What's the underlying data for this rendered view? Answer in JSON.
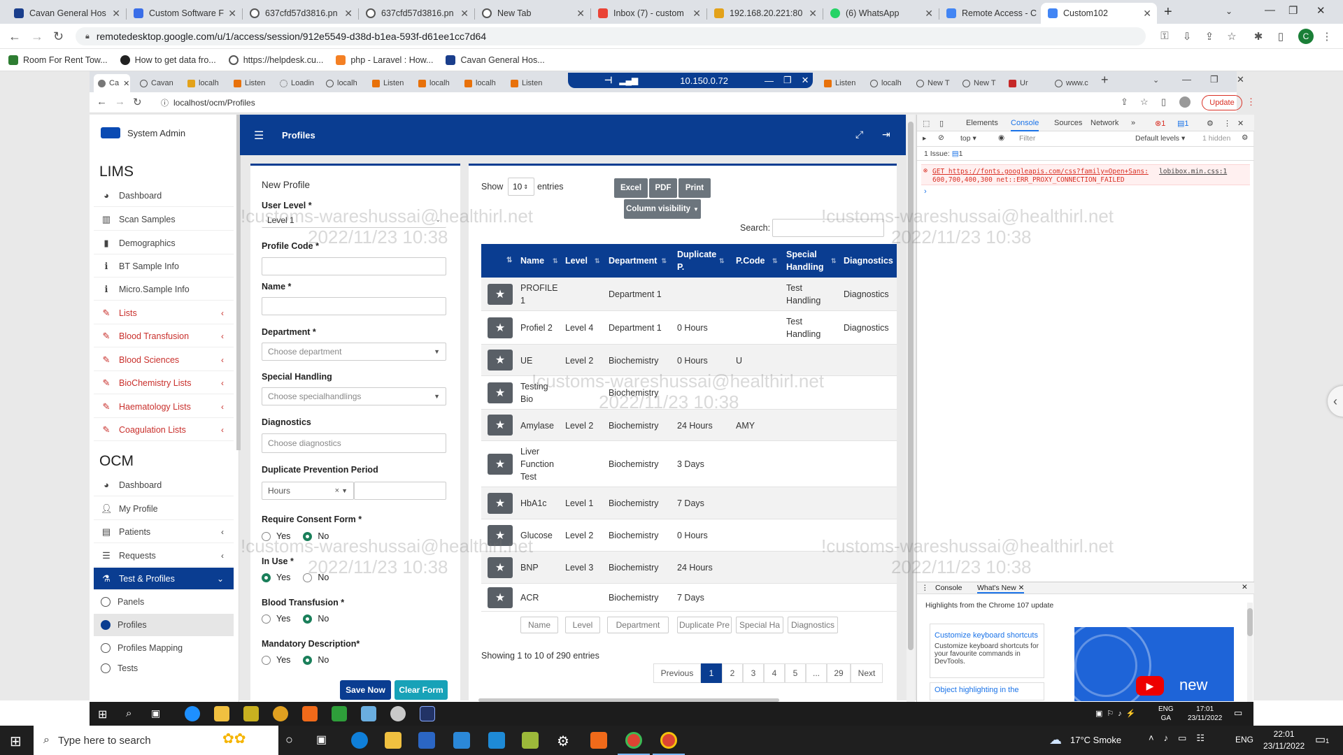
{
  "browser": {
    "tabs": [
      {
        "label": "Cavan General Hos"
      },
      {
        "label": "Custom Software F"
      },
      {
        "label": "637cfd57d3816.pn"
      },
      {
        "label": "637cfd57d3816.pn"
      },
      {
        "label": "New Tab"
      },
      {
        "label": "Inbox (7) - custom"
      },
      {
        "label": "192.168.20.221:80"
      },
      {
        "label": "(6) WhatsApp"
      },
      {
        "label": "Remote Access - C"
      },
      {
        "label": "Custom102"
      }
    ],
    "url": "remotedesktop.google.com/u/1/access/session/912e5549-d38d-b1ea-593f-d61ee1cc7d64",
    "profile_initial": "C",
    "bookmarks": [
      {
        "label": "Room For Rent Tow..."
      },
      {
        "label": "How to get data fro..."
      },
      {
        "label": "https://helpdesk.cu..."
      },
      {
        "label": "php - Laravel : How..."
      },
      {
        "label": "Cavan General Hos..."
      }
    ]
  },
  "remote": {
    "ip": "10.150.0.72",
    "inner_tabs": [
      "Ca",
      "Cavan",
      "localh",
      "Listen",
      "Loadin",
      "localh",
      "Listen",
      "localh",
      "localh",
      "Listen",
      "Listen",
      "localh",
      "New T",
      "New T",
      "Ur",
      "www.c"
    ],
    "inner_url": "localhost/ocm/Profiles",
    "update_label": "Update"
  },
  "sidebar": {
    "brand": "System Admin",
    "lims_title": "LIMS",
    "lims_items": [
      {
        "label": "Dashboard",
        "icon": "dashboard-icon"
      },
      {
        "label": "Scan Samples",
        "icon": "barcode-icon"
      },
      {
        "label": "Demographics",
        "icon": "file-icon"
      },
      {
        "label": "BT Sample Info",
        "icon": "info-icon"
      },
      {
        "label": "Micro.Sample Info",
        "icon": "info-icon"
      },
      {
        "label": "Lists",
        "icon": "pencil-icon"
      },
      {
        "label": "Blood Transfusion",
        "icon": "pencil-icon"
      },
      {
        "label": "Blood Sciences",
        "icon": "pencil-icon"
      },
      {
        "label": "BioChemistry Lists",
        "icon": "pencil-icon"
      },
      {
        "label": "Haematology Lists",
        "icon": "pencil-icon"
      },
      {
        "label": "Coagulation Lists",
        "icon": "pencil-icon"
      }
    ],
    "ocm_title": "OCM",
    "ocm_items": [
      {
        "label": "Dashboard"
      },
      {
        "label": "My Profile"
      },
      {
        "label": "Patients"
      },
      {
        "label": "Requests"
      },
      {
        "label": "Test & Profiles"
      },
      {
        "label": "Panels"
      },
      {
        "label": "Profiles"
      },
      {
        "label": "Profiles Mapping"
      },
      {
        "label": "Tests"
      }
    ]
  },
  "header": {
    "title": "Profiles"
  },
  "form": {
    "title": "New Profile",
    "user_level_label": "User Level *",
    "user_level_value": "Level 1",
    "profile_code_label": "Profile Code *",
    "name_label": "Name *",
    "department_label": "Department *",
    "department_placeholder": "Choose department",
    "special_label": "Special Handling",
    "special_placeholder": "Choose specialhandlings",
    "diagnostics_label": "Diagnostics",
    "diagnostics_placeholder": "Choose diagnostics",
    "dup_label": "Duplicate Prevention Period",
    "dup_unit": "Hours",
    "consent_label": "Require Consent Form *",
    "inuse_label": "In Use *",
    "bt_label": "Blood Transfusion *",
    "mand_label": "Mandatory Description*",
    "yes": "Yes",
    "no": "No",
    "save": "Save Now",
    "clear": "Clear Form"
  },
  "table": {
    "show": "Show",
    "entries_value": "10",
    "entries": "entries",
    "buttons": [
      "Excel",
      "PDF",
      "Print"
    ],
    "colvis": "Column visibility",
    "search_label": "Search:",
    "columns": [
      "Name",
      "Level",
      "Department",
      "Duplicate P.",
      "P.Code",
      "Special Handling",
      "Diagnostics"
    ],
    "rows": [
      {
        "name": "PROFILE 1",
        "level": "",
        "dept": "Department 1",
        "dup": "",
        "code": "",
        "special": "Test Handling",
        "diag": "Diagnostics"
      },
      {
        "name": "Profiel 2",
        "level": "Level 4",
        "dept": "Department 1",
        "dup": "0 Hours",
        "code": "",
        "special": "Test Handling",
        "diag": "Diagnostics"
      },
      {
        "name": "UE",
        "level": "Level 2",
        "dept": "Biochemistry",
        "dup": "0 Hours",
        "code": "U",
        "special": "",
        "diag": ""
      },
      {
        "name": "Testing Bio",
        "level": "",
        "dept": "Biochemistry",
        "dup": "",
        "code": "",
        "special": "",
        "diag": ""
      },
      {
        "name": "Amylase",
        "level": "Level 2",
        "dept": "Biochemistry",
        "dup": "24 Hours",
        "code": "AMY",
        "special": "",
        "diag": ""
      },
      {
        "name": "Liver Function Test",
        "level": "",
        "dept": "Biochemistry",
        "dup": "3 Days",
        "code": "",
        "special": "",
        "diag": ""
      },
      {
        "name": "HbA1c",
        "level": "Level 1",
        "dept": "Biochemistry",
        "dup": "7 Days",
        "code": "",
        "special": "",
        "diag": ""
      },
      {
        "name": "Glucose",
        "level": "Level 2",
        "dept": "Biochemistry",
        "dup": "0 Hours",
        "code": "",
        "special": "",
        "diag": ""
      },
      {
        "name": "BNP",
        "level": "Level 3",
        "dept": "Biochemistry",
        "dup": "24 Hours",
        "code": "",
        "special": "",
        "diag": ""
      },
      {
        "name": "ACR",
        "level": "",
        "dept": "Biochemistry",
        "dup": "7 Days",
        "code": "",
        "special": "",
        "diag": ""
      }
    ],
    "filters": [
      "Name",
      "Level",
      "Department",
      "Duplicate Pre",
      "Special Ha",
      "Diagnostics"
    ],
    "info": "Showing 1 to 10 of 290 entries",
    "pages": [
      "Previous",
      "1",
      "2",
      "3",
      "4",
      "5",
      "...",
      "29",
      "Next"
    ]
  },
  "devtools": {
    "tabs": [
      "Elements",
      "Console",
      "Sources",
      "Network"
    ],
    "err_count": "1",
    "msg_count": "1",
    "context": "top",
    "filter_placeholder": "Filter",
    "levels": "Default levels",
    "hidden": "1 hidden",
    "issues": "1 Issue:",
    "issues_count": "1",
    "error_line1": "GET https://fonts.googleapis.com/css?family=Open+Sans:",
    "error_line2": "600,700,400,300 net::ERR_PROXY_CONNECTION_FAILED",
    "error_source": "lobibox.min.css:1",
    "drawer_tabs": [
      "Console",
      "What's New"
    ],
    "whats_new_title": "Highlights from the Chrome 107 update",
    "card1_title": "Customize keyboard shortcuts",
    "card1_text": "Customize keyboard shortcuts for your favourite commands in DevTools.",
    "card2_title": "Object highlighting in the",
    "video_label": "new"
  },
  "remote_taskbar": {
    "lang": "ENG",
    "region": "GA",
    "time": "17:01",
    "date": "23/11/2022"
  },
  "watermark": {
    "email": "!customs-wareshussai@healthirl.net",
    "stamp": "2022/11/23 10:38"
  },
  "taskbar": {
    "search_placeholder": "Type here to search",
    "weather": "17°C Smoke",
    "lang": "ENG",
    "time": "22:01",
    "date": "23/11/2022",
    "notif_count": "1"
  }
}
